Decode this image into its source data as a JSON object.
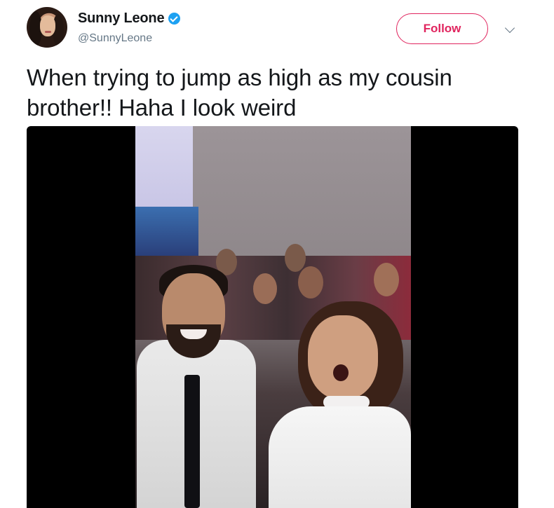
{
  "author": {
    "display_name": "Sunny Leone",
    "handle": "@SunnyLeone",
    "verified_icon": "verified-badge-icon",
    "avatar_icon": "profile-avatar"
  },
  "actions": {
    "follow_label": "Follow",
    "menu_icon": "chevron-down-icon"
  },
  "tweet": {
    "text": "When trying to jump as high as my cousin brother!! Haha I look weird"
  },
  "media": {
    "type": "video",
    "icon": "video-player"
  },
  "colors": {
    "accent": "#e0245e",
    "verified": "#1da1f2",
    "handle": "#657786",
    "text": "#14171a",
    "media_background": "#000000"
  }
}
